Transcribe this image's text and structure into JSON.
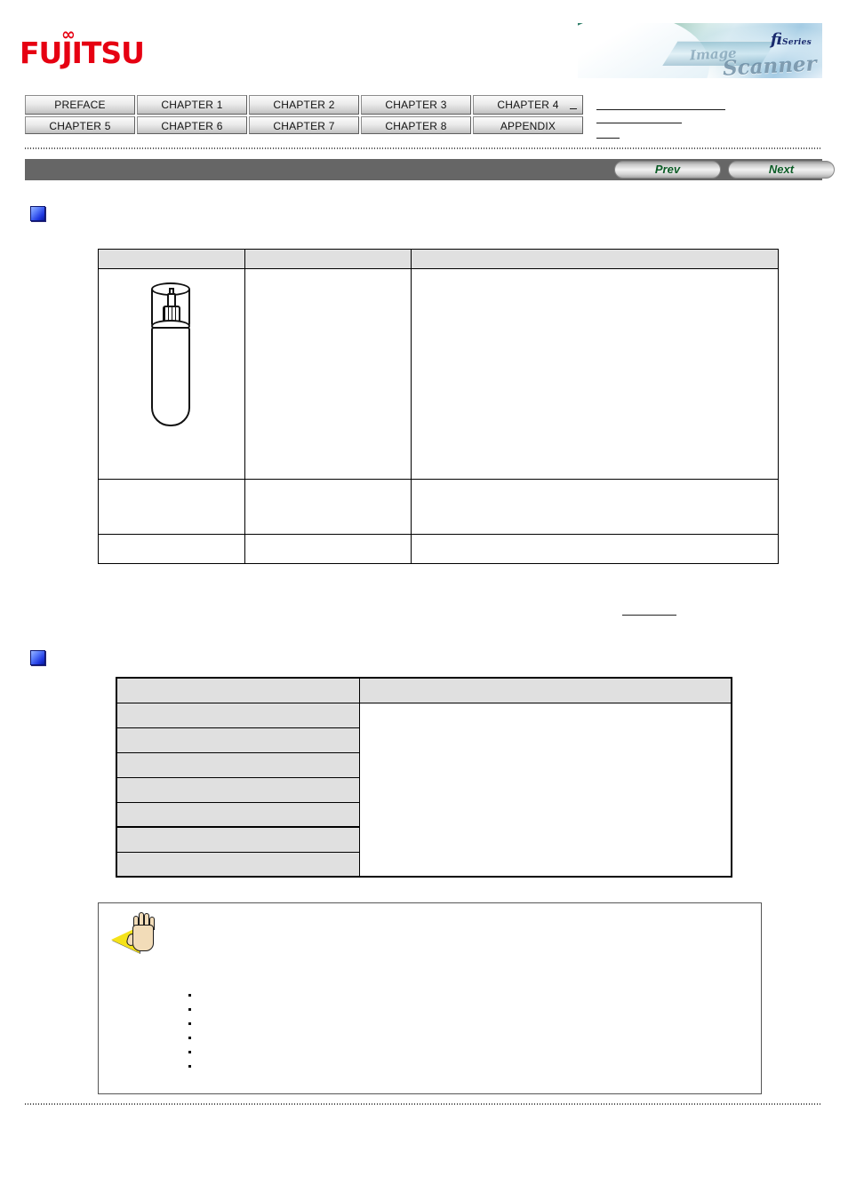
{
  "brand": {
    "logo_text": "FUJITSU",
    "logo_color": "#e60012",
    "infinity_glyph": "∞",
    "banner_product": "fi",
    "banner_series": "Series",
    "banner_subtitle_image": "Image",
    "banner_subtitle_scanner": "Scanner"
  },
  "nav": {
    "tabs": [
      {
        "label": "PREFACE"
      },
      {
        "label": "CHAPTER 1"
      },
      {
        "label": "CHAPTER 2"
      },
      {
        "label": "CHAPTER 3"
      },
      {
        "label": "CHAPTER 4"
      },
      {
        "label": "CHAPTER 5"
      },
      {
        "label": "CHAPTER 6"
      },
      {
        "label": "CHAPTER 7"
      },
      {
        "label": "CHAPTER 8"
      },
      {
        "label": "APPENDIX"
      }
    ],
    "side_links": [
      {
        "label": ""
      },
      {
        "label": ""
      },
      {
        "label": ""
      }
    ]
  },
  "toolbar": {
    "prev_label": "Prev",
    "next_label": "Next",
    "band_color": "#666666",
    "button_text_color": "#0b5c26"
  },
  "sections": [
    {
      "bullet_icon": "blue-square-bullet-icon",
      "title": ""
    },
    {
      "bullet_icon": "blue-square-bullet-icon",
      "title": ""
    }
  ],
  "table1": {
    "headers": [
      "",
      "",
      ""
    ],
    "rows": [
      {
        "image": "cleaner-spray-bottle-illustration",
        "col2": "",
        "col3": ""
      },
      {
        "image": "",
        "col2": "",
        "col3": ""
      },
      {
        "image": "",
        "col2": "",
        "col3": ""
      }
    ]
  },
  "mid_link": {
    "label": ""
  },
  "table2": {
    "headers": [
      "",
      ""
    ],
    "rows": [
      {
        "label": "",
        "value": ""
      },
      {
        "label": "",
        "value": ""
      },
      {
        "label": "",
        "value": ""
      },
      {
        "label": "",
        "value": ""
      },
      {
        "label": "",
        "value": ""
      },
      {
        "label": "",
        "value": ""
      },
      {
        "label": "",
        "value": ""
      }
    ]
  },
  "note": {
    "icon": "caution-hand-icon",
    "body": "",
    "bullets": [
      "",
      "",
      "",
      "",
      "",
      ""
    ]
  }
}
